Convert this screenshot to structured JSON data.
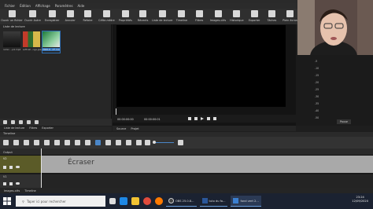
{
  "menu": [
    "Fichier",
    "Édition",
    "Affichage",
    "Paramètres",
    "Aide"
  ],
  "toolbar": [
    {
      "label": "Ouvrir un fichier",
      "icon": "folder-open-icon"
    },
    {
      "label": "Ouvrir Autre",
      "icon": "open-other-icon"
    },
    {
      "label": "Enregistrer",
      "icon": "save-icon"
    },
    {
      "label": "Annuler",
      "icon": "undo-icon"
    },
    {
      "label": "Refaire",
      "icon": "redo-icon"
    },
    {
      "label": "Crête-mètre",
      "icon": "peak-meter-icon"
    },
    {
      "label": "Propriétés",
      "icon": "properties-icon"
    },
    {
      "label": "Récents",
      "icon": "recent-icon"
    },
    {
      "label": "Liste de lecture",
      "icon": "playlist-icon"
    },
    {
      "label": "Timeline",
      "icon": "timeline-icon"
    },
    {
      "label": "Filtres",
      "icon": "filter-icon"
    },
    {
      "label": "Images-clés",
      "icon": "keyframes-icon"
    },
    {
      "label": "Historique",
      "icon": "history-icon"
    },
    {
      "label": "Exporter",
      "icon": "export-icon"
    },
    {
      "label": "Tâches",
      "icon": "jobs-icon"
    },
    {
      "label": "Plein écran",
      "icon": "fullscreen-icon"
    }
  ],
  "playlist": {
    "title": "Liste de lecture",
    "items": [
      {
        "name": "remix ...p4.mp4"
      },
      {
        "name": "softcell...nge.jpeg"
      },
      {
        "name": "2020-0...27.mov"
      }
    ],
    "tabs": [
      "Liste de lecture",
      "Filtres",
      "Exporter"
    ]
  },
  "viewer": {
    "timecode": "00:00:00:00",
    "duration": "00:00:00:01",
    "tabs": [
      "Source",
      "Projet"
    ]
  },
  "meter": {
    "labels": [
      "-5",
      "-10",
      "-15",
      "-20",
      "-25",
      "-30",
      "-35",
      "-40",
      "-50"
    ],
    "pause": "Pause"
  },
  "timeline": {
    "title": "Timeline",
    "output": "Output",
    "track1": {
      "name": "V2",
      "clip": "Écraser"
    },
    "track2": {
      "name": "V1"
    },
    "tabs": [
      "Images-clés",
      "Timeline"
    ]
  },
  "taskbar": {
    "search_placeholder": "Taper ici pour rechercher",
    "apps": [
      "OBS 25.0.8...",
      "tuto du fo...",
      "fond vert 2..."
    ],
    "time": "23:24",
    "date": "12/09/2020"
  }
}
